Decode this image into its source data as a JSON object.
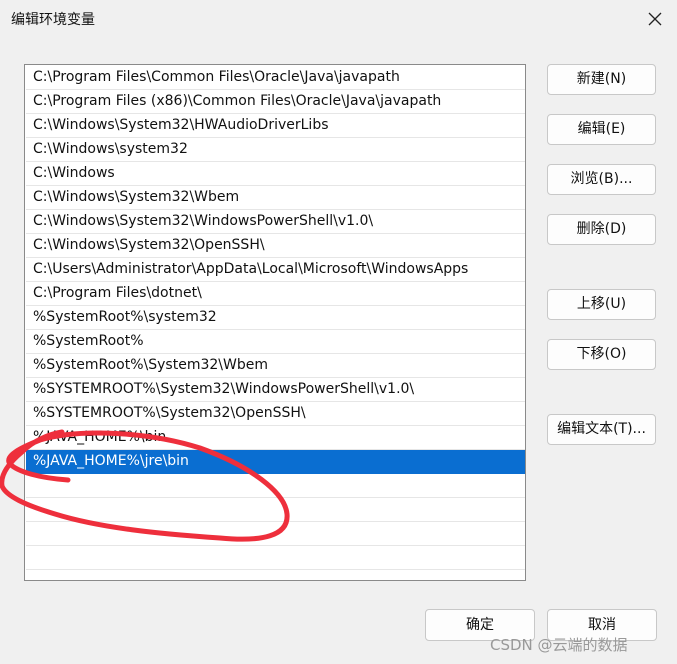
{
  "window": {
    "title": "编辑环境变量",
    "close_icon": "close-icon"
  },
  "paths": [
    "C:\\Program Files\\Common Files\\Oracle\\Java\\javapath",
    "C:\\Program Files (x86)\\Common Files\\Oracle\\Java\\javapath",
    "C:\\Windows\\System32\\HWAudioDriverLibs",
    "C:\\Windows\\system32",
    "C:\\Windows",
    "C:\\Windows\\System32\\Wbem",
    "C:\\Windows\\System32\\WindowsPowerShell\\v1.0\\",
    "C:\\Windows\\System32\\OpenSSH\\",
    "C:\\Users\\Administrator\\AppData\\Local\\Microsoft\\WindowsApps",
    "C:\\Program Files\\dotnet\\",
    "%SystemRoot%\\system32",
    "%SystemRoot%",
    "%SystemRoot%\\System32\\Wbem",
    "%SYSTEMROOT%\\System32\\WindowsPowerShell\\v1.0\\",
    "%SYSTEMROOT%\\System32\\OpenSSH\\",
    "%JAVA_HOME%\\bin",
    "%JAVA_HOME%\\jre\\bin"
  ],
  "selected_index": 16,
  "buttons": {
    "new": "新建(N)",
    "edit": "编辑(E)",
    "browse": "浏览(B)...",
    "delete": "删除(D)",
    "move_up": "上移(U)",
    "move_down": "下移(O)",
    "edit_text": "编辑文本(T)...",
    "ok": "确定",
    "cancel": "取消"
  },
  "watermark": "CSDN @云端的数据",
  "colors": {
    "selection": "#0a6ed1",
    "annotation": "#ee2f3c"
  }
}
